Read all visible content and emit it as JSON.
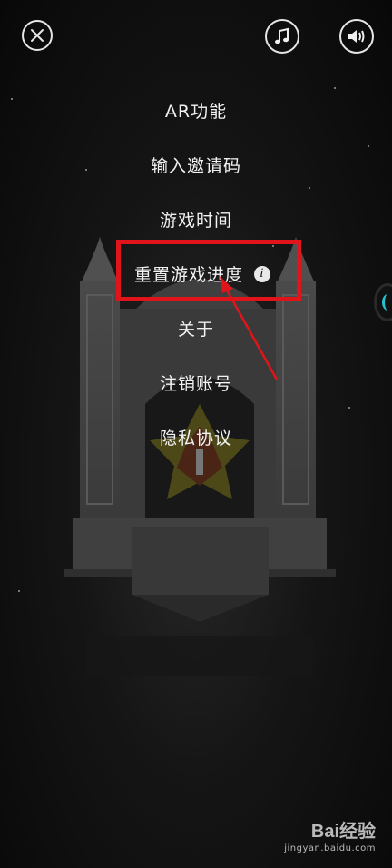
{
  "top_bar": {
    "close_icon": "close-icon",
    "music_icon": "music-note-icon",
    "sound_icon": "speaker-icon"
  },
  "menu": {
    "items": [
      {
        "label": "AR功能"
      },
      {
        "label": "输入邀请码"
      },
      {
        "label": "游戏时间"
      },
      {
        "label": "重置游戏进度"
      },
      {
        "label": "关于"
      },
      {
        "label": "注销账号"
      },
      {
        "label": "隐私协议"
      }
    ],
    "info_glyph": "i"
  },
  "annotation": {
    "highlight_color": "#e0141b",
    "arrow_color": "#e0141b"
  },
  "watermark": {
    "brand": "Bai经验",
    "url": "jingyan.baidu.com"
  },
  "colors": {
    "background": "#0d0d0d",
    "text": "#f2f2f2",
    "accent": "#23c4cf"
  }
}
